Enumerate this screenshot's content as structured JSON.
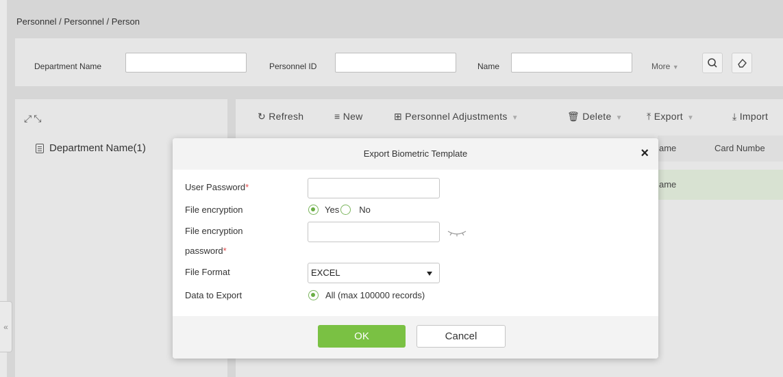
{
  "breadcrumb": "Personnel / Personnel / Person",
  "search": {
    "department_label": "Department Name",
    "department_value": "",
    "personnel_id_label": "Personnel ID",
    "personnel_id_value": "",
    "name_label": "Name",
    "name_value": "",
    "more_label": "More",
    "search_icon": "search-icon",
    "clear_icon": "eraser-icon"
  },
  "tree": {
    "expand_icon": "expand-icon",
    "collapse_icon": "collapse-icon",
    "root_label": "Department Name(1)"
  },
  "toolbar": {
    "refresh": "Refresh",
    "new": "New",
    "adjustments": "Personnel Adjustments",
    "delete": "Delete",
    "export": "Export",
    "import": "Import"
  },
  "grid": {
    "headers": [
      "ame",
      "Card Numbe"
    ],
    "rows": [
      [
        "ame",
        ""
      ]
    ]
  },
  "sidebar_toggle": "«",
  "dialog": {
    "title": "Export Biometric Template",
    "close": "×",
    "user_password_label": "User Password",
    "user_password_value": "",
    "required_mark": "*",
    "file_encryption_label": "File encryption",
    "encryption_yes": "Yes",
    "encryption_no": "No",
    "encryption_selected": "Yes",
    "encryption_password_label_1": "File encryption",
    "encryption_password_label_2": "password",
    "encryption_password_value": "",
    "file_format_label": "File Format",
    "file_format_value": "EXCEL",
    "data_to_export_label": "Data to Export",
    "data_to_export_option": "All (max 100000 records)",
    "ok": "OK",
    "cancel": "Cancel"
  },
  "colors": {
    "accent_green": "#7ac143",
    "required_red": "#e24a4a"
  }
}
